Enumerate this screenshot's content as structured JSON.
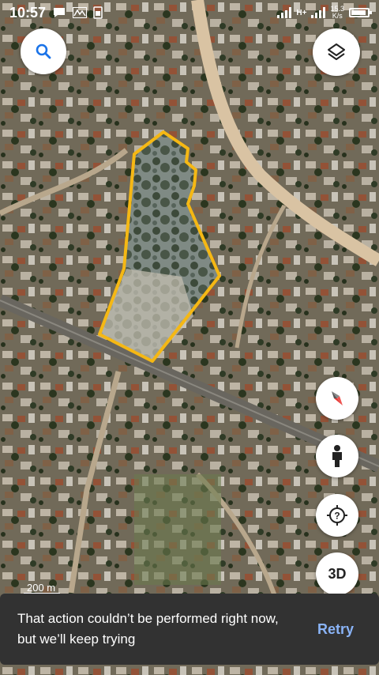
{
  "status_bar": {
    "time": "10:57",
    "net_speed_value": "15.3",
    "net_speed_unit": "K/s",
    "network": "H+"
  },
  "map": {
    "scale_label": "200 m",
    "boundary_color": "#f5b814"
  },
  "controls": {
    "search": "search-icon",
    "layers": "layers-icon",
    "compass": "compass-icon",
    "street_view": "pegman-icon",
    "my_location": "location-icon",
    "three_d_label": "3D"
  },
  "snackbar": {
    "message": "That action couldn’t be performed right now, but we’ll keep trying",
    "action": "Retry"
  }
}
